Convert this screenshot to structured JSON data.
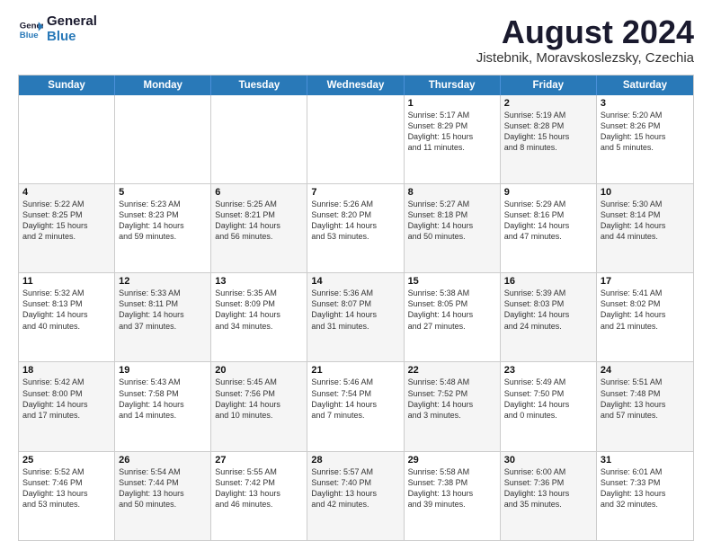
{
  "logo": {
    "line1": "General",
    "line2": "Blue"
  },
  "title": "August 2024",
  "subtitle": "Jistebnik, Moravskoslezsky, Czechia",
  "header_days": [
    "Sunday",
    "Monday",
    "Tuesday",
    "Wednesday",
    "Thursday",
    "Friday",
    "Saturday"
  ],
  "rows": [
    [
      {
        "day": "",
        "info": "",
        "shade": false
      },
      {
        "day": "",
        "info": "",
        "shade": false
      },
      {
        "day": "",
        "info": "",
        "shade": false
      },
      {
        "day": "",
        "info": "",
        "shade": false
      },
      {
        "day": "1",
        "info": "Sunrise: 5:17 AM\nSunset: 8:29 PM\nDaylight: 15 hours\nand 11 minutes.",
        "shade": false
      },
      {
        "day": "2",
        "info": "Sunrise: 5:19 AM\nSunset: 8:28 PM\nDaylight: 15 hours\nand 8 minutes.",
        "shade": true
      },
      {
        "day": "3",
        "info": "Sunrise: 5:20 AM\nSunset: 8:26 PM\nDaylight: 15 hours\nand 5 minutes.",
        "shade": false
      }
    ],
    [
      {
        "day": "4",
        "info": "Sunrise: 5:22 AM\nSunset: 8:25 PM\nDaylight: 15 hours\nand 2 minutes.",
        "shade": true
      },
      {
        "day": "5",
        "info": "Sunrise: 5:23 AM\nSunset: 8:23 PM\nDaylight: 14 hours\nand 59 minutes.",
        "shade": false
      },
      {
        "day": "6",
        "info": "Sunrise: 5:25 AM\nSunset: 8:21 PM\nDaylight: 14 hours\nand 56 minutes.",
        "shade": true
      },
      {
        "day": "7",
        "info": "Sunrise: 5:26 AM\nSunset: 8:20 PM\nDaylight: 14 hours\nand 53 minutes.",
        "shade": false
      },
      {
        "day": "8",
        "info": "Sunrise: 5:27 AM\nSunset: 8:18 PM\nDaylight: 14 hours\nand 50 minutes.",
        "shade": true
      },
      {
        "day": "9",
        "info": "Sunrise: 5:29 AM\nSunset: 8:16 PM\nDaylight: 14 hours\nand 47 minutes.",
        "shade": false
      },
      {
        "day": "10",
        "info": "Sunrise: 5:30 AM\nSunset: 8:14 PM\nDaylight: 14 hours\nand 44 minutes.",
        "shade": true
      }
    ],
    [
      {
        "day": "11",
        "info": "Sunrise: 5:32 AM\nSunset: 8:13 PM\nDaylight: 14 hours\nand 40 minutes.",
        "shade": false
      },
      {
        "day": "12",
        "info": "Sunrise: 5:33 AM\nSunset: 8:11 PM\nDaylight: 14 hours\nand 37 minutes.",
        "shade": true
      },
      {
        "day": "13",
        "info": "Sunrise: 5:35 AM\nSunset: 8:09 PM\nDaylight: 14 hours\nand 34 minutes.",
        "shade": false
      },
      {
        "day": "14",
        "info": "Sunrise: 5:36 AM\nSunset: 8:07 PM\nDaylight: 14 hours\nand 31 minutes.",
        "shade": true
      },
      {
        "day": "15",
        "info": "Sunrise: 5:38 AM\nSunset: 8:05 PM\nDaylight: 14 hours\nand 27 minutes.",
        "shade": false
      },
      {
        "day": "16",
        "info": "Sunrise: 5:39 AM\nSunset: 8:03 PM\nDaylight: 14 hours\nand 24 minutes.",
        "shade": true
      },
      {
        "day": "17",
        "info": "Sunrise: 5:41 AM\nSunset: 8:02 PM\nDaylight: 14 hours\nand 21 minutes.",
        "shade": false
      }
    ],
    [
      {
        "day": "18",
        "info": "Sunrise: 5:42 AM\nSunset: 8:00 PM\nDaylight: 14 hours\nand 17 minutes.",
        "shade": true
      },
      {
        "day": "19",
        "info": "Sunrise: 5:43 AM\nSunset: 7:58 PM\nDaylight: 14 hours\nand 14 minutes.",
        "shade": false
      },
      {
        "day": "20",
        "info": "Sunrise: 5:45 AM\nSunset: 7:56 PM\nDaylight: 14 hours\nand 10 minutes.",
        "shade": true
      },
      {
        "day": "21",
        "info": "Sunrise: 5:46 AM\nSunset: 7:54 PM\nDaylight: 14 hours\nand 7 minutes.",
        "shade": false
      },
      {
        "day": "22",
        "info": "Sunrise: 5:48 AM\nSunset: 7:52 PM\nDaylight: 14 hours\nand 3 minutes.",
        "shade": true
      },
      {
        "day": "23",
        "info": "Sunrise: 5:49 AM\nSunset: 7:50 PM\nDaylight: 14 hours\nand 0 minutes.",
        "shade": false
      },
      {
        "day": "24",
        "info": "Sunrise: 5:51 AM\nSunset: 7:48 PM\nDaylight: 13 hours\nand 57 minutes.",
        "shade": true
      }
    ],
    [
      {
        "day": "25",
        "info": "Sunrise: 5:52 AM\nSunset: 7:46 PM\nDaylight: 13 hours\nand 53 minutes.",
        "shade": false
      },
      {
        "day": "26",
        "info": "Sunrise: 5:54 AM\nSunset: 7:44 PM\nDaylight: 13 hours\nand 50 minutes.",
        "shade": true
      },
      {
        "day": "27",
        "info": "Sunrise: 5:55 AM\nSunset: 7:42 PM\nDaylight: 13 hours\nand 46 minutes.",
        "shade": false
      },
      {
        "day": "28",
        "info": "Sunrise: 5:57 AM\nSunset: 7:40 PM\nDaylight: 13 hours\nand 42 minutes.",
        "shade": true
      },
      {
        "day": "29",
        "info": "Sunrise: 5:58 AM\nSunset: 7:38 PM\nDaylight: 13 hours\nand 39 minutes.",
        "shade": false
      },
      {
        "day": "30",
        "info": "Sunrise: 6:00 AM\nSunset: 7:36 PM\nDaylight: 13 hours\nand 35 minutes.",
        "shade": true
      },
      {
        "day": "31",
        "info": "Sunrise: 6:01 AM\nSunset: 7:33 PM\nDaylight: 13 hours\nand 32 minutes.",
        "shade": false
      }
    ]
  ]
}
